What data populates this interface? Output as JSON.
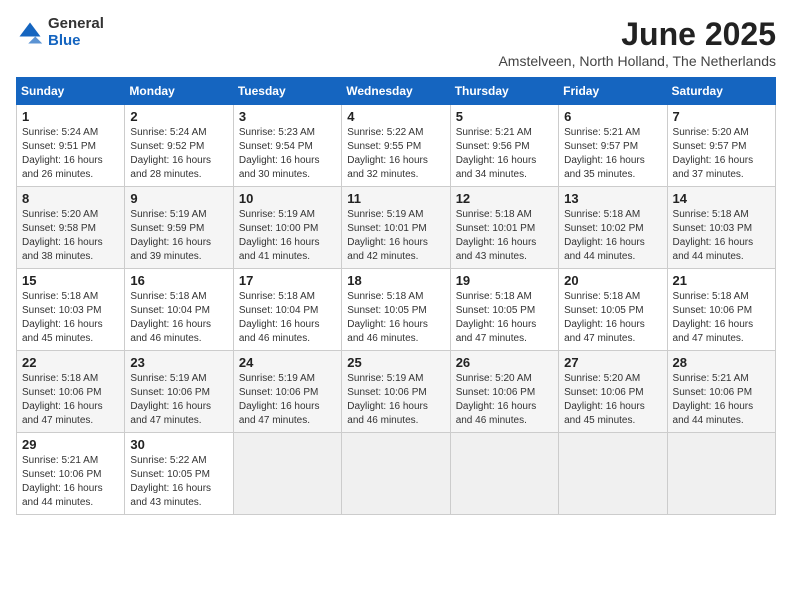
{
  "header": {
    "logo_line1": "General",
    "logo_line2": "Blue",
    "month_title": "June 2025",
    "subtitle": "Amstelveen, North Holland, The Netherlands"
  },
  "days_of_week": [
    "Sunday",
    "Monday",
    "Tuesday",
    "Wednesday",
    "Thursday",
    "Friday",
    "Saturday"
  ],
  "weeks": [
    [
      {
        "day": 1,
        "sunrise": "5:24 AM",
        "sunset": "9:51 PM",
        "daylight": "16 hours and 26 minutes."
      },
      {
        "day": 2,
        "sunrise": "5:24 AM",
        "sunset": "9:52 PM",
        "daylight": "16 hours and 28 minutes."
      },
      {
        "day": 3,
        "sunrise": "5:23 AM",
        "sunset": "9:54 PM",
        "daylight": "16 hours and 30 minutes."
      },
      {
        "day": 4,
        "sunrise": "5:22 AM",
        "sunset": "9:55 PM",
        "daylight": "16 hours and 32 minutes."
      },
      {
        "day": 5,
        "sunrise": "5:21 AM",
        "sunset": "9:56 PM",
        "daylight": "16 hours and 34 minutes."
      },
      {
        "day": 6,
        "sunrise": "5:21 AM",
        "sunset": "9:57 PM",
        "daylight": "16 hours and 35 minutes."
      },
      {
        "day": 7,
        "sunrise": "5:20 AM",
        "sunset": "9:57 PM",
        "daylight": "16 hours and 37 minutes."
      }
    ],
    [
      {
        "day": 8,
        "sunrise": "5:20 AM",
        "sunset": "9:58 PM",
        "daylight": "16 hours and 38 minutes."
      },
      {
        "day": 9,
        "sunrise": "5:19 AM",
        "sunset": "9:59 PM",
        "daylight": "16 hours and 39 minutes."
      },
      {
        "day": 10,
        "sunrise": "5:19 AM",
        "sunset": "10:00 PM",
        "daylight": "16 hours and 41 minutes."
      },
      {
        "day": 11,
        "sunrise": "5:19 AM",
        "sunset": "10:01 PM",
        "daylight": "16 hours and 42 minutes."
      },
      {
        "day": 12,
        "sunrise": "5:18 AM",
        "sunset": "10:01 PM",
        "daylight": "16 hours and 43 minutes."
      },
      {
        "day": 13,
        "sunrise": "5:18 AM",
        "sunset": "10:02 PM",
        "daylight": "16 hours and 44 minutes."
      },
      {
        "day": 14,
        "sunrise": "5:18 AM",
        "sunset": "10:03 PM",
        "daylight": "16 hours and 44 minutes."
      }
    ],
    [
      {
        "day": 15,
        "sunrise": "5:18 AM",
        "sunset": "10:03 PM",
        "daylight": "16 hours and 45 minutes."
      },
      {
        "day": 16,
        "sunrise": "5:18 AM",
        "sunset": "10:04 PM",
        "daylight": "16 hours and 46 minutes."
      },
      {
        "day": 17,
        "sunrise": "5:18 AM",
        "sunset": "10:04 PM",
        "daylight": "16 hours and 46 minutes."
      },
      {
        "day": 18,
        "sunrise": "5:18 AM",
        "sunset": "10:05 PM",
        "daylight": "16 hours and 46 minutes."
      },
      {
        "day": 19,
        "sunrise": "5:18 AM",
        "sunset": "10:05 PM",
        "daylight": "16 hours and 47 minutes."
      },
      {
        "day": 20,
        "sunrise": "5:18 AM",
        "sunset": "10:05 PM",
        "daylight": "16 hours and 47 minutes."
      },
      {
        "day": 21,
        "sunrise": "5:18 AM",
        "sunset": "10:06 PM",
        "daylight": "16 hours and 47 minutes."
      }
    ],
    [
      {
        "day": 22,
        "sunrise": "5:18 AM",
        "sunset": "10:06 PM",
        "daylight": "16 hours and 47 minutes."
      },
      {
        "day": 23,
        "sunrise": "5:19 AM",
        "sunset": "10:06 PM",
        "daylight": "16 hours and 47 minutes."
      },
      {
        "day": 24,
        "sunrise": "5:19 AM",
        "sunset": "10:06 PM",
        "daylight": "16 hours and 47 minutes."
      },
      {
        "day": 25,
        "sunrise": "5:19 AM",
        "sunset": "10:06 PM",
        "daylight": "16 hours and 46 minutes."
      },
      {
        "day": 26,
        "sunrise": "5:20 AM",
        "sunset": "10:06 PM",
        "daylight": "16 hours and 46 minutes."
      },
      {
        "day": 27,
        "sunrise": "5:20 AM",
        "sunset": "10:06 PM",
        "daylight": "16 hours and 45 minutes."
      },
      {
        "day": 28,
        "sunrise": "5:21 AM",
        "sunset": "10:06 PM",
        "daylight": "16 hours and 44 minutes."
      }
    ],
    [
      {
        "day": 29,
        "sunrise": "5:21 AM",
        "sunset": "10:06 PM",
        "daylight": "16 hours and 44 minutes."
      },
      {
        "day": 30,
        "sunrise": "5:22 AM",
        "sunset": "10:05 PM",
        "daylight": "16 hours and 43 minutes."
      },
      null,
      null,
      null,
      null,
      null
    ]
  ]
}
